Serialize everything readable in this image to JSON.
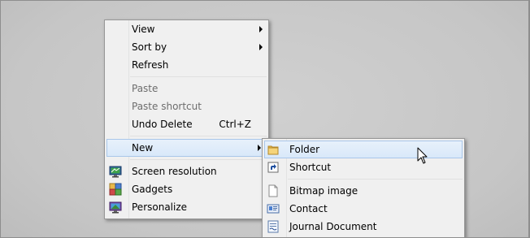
{
  "context_menu": {
    "items": [
      {
        "label": "View",
        "has_submenu": true
      },
      {
        "label": "Sort by",
        "has_submenu": true
      },
      {
        "label": "Refresh"
      },
      {
        "label": "Paste",
        "disabled": true
      },
      {
        "label": "Paste shortcut",
        "disabled": true
      },
      {
        "label": "Undo Delete",
        "shortcut": "Ctrl+Z"
      },
      {
        "label": "New",
        "has_submenu": true,
        "highlighted": true
      },
      {
        "label": "Screen resolution",
        "icon": "screen-resolution-icon"
      },
      {
        "label": "Gadgets",
        "icon": "gadgets-icon"
      },
      {
        "label": "Personalize",
        "icon": "personalize-icon"
      }
    ]
  },
  "new_submenu": {
    "items": [
      {
        "label": "Folder",
        "icon": "folder-icon",
        "highlighted": true
      },
      {
        "label": "Shortcut",
        "icon": "shortcut-icon"
      },
      {
        "label": "Bitmap image",
        "icon": "bitmap-image-icon"
      },
      {
        "label": "Contact",
        "icon": "contact-icon"
      },
      {
        "label": "Journal Document",
        "icon": "journal-document-icon"
      }
    ]
  },
  "colors": {
    "highlight_fill": "#dbe9f9",
    "highlight_border": "#a9c7ea",
    "menu_background": "#f0f0f0",
    "disabled_text": "#6d6d6d"
  }
}
